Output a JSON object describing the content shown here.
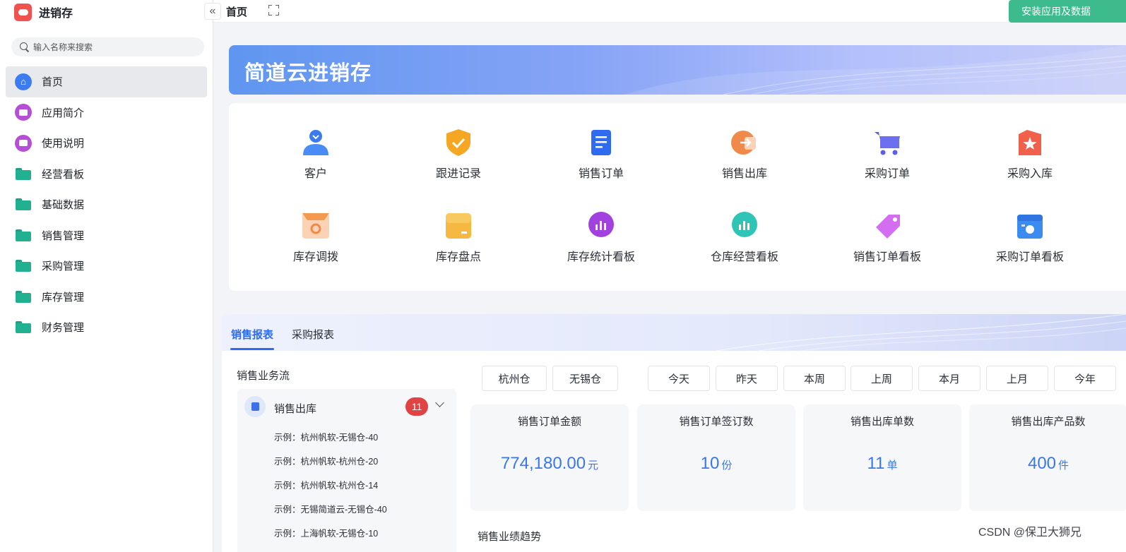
{
  "app": {
    "title": "进销存"
  },
  "sidebar": {
    "search_placeholder": "输入名称来搜索",
    "items": [
      {
        "label": "首页",
        "icon": "home-icon",
        "active": true
      },
      {
        "label": "应用简介",
        "icon": "intro-icon"
      },
      {
        "label": "使用说明",
        "icon": "manual-icon"
      },
      {
        "label": "经营看板",
        "icon": "folder-icon"
      },
      {
        "label": "基础数据",
        "icon": "folder-icon"
      },
      {
        "label": "销售管理",
        "icon": "folder-icon"
      },
      {
        "label": "采购管理",
        "icon": "folder-icon"
      },
      {
        "label": "库存管理",
        "icon": "folder-icon"
      },
      {
        "label": "财务管理",
        "icon": "folder-icon"
      }
    ]
  },
  "topbar": {
    "collapse_glyph": "«",
    "tab": "首页",
    "install_label": "安装应用及数据"
  },
  "banner": {
    "title": "简道云进销存"
  },
  "shortcuts": [
    {
      "label": "客户",
      "icon": "customer-icon"
    },
    {
      "label": "跟进记录",
      "icon": "follow-up-icon"
    },
    {
      "label": "销售订单",
      "icon": "sales-order-icon"
    },
    {
      "label": "销售出库",
      "icon": "sales-outbound-icon"
    },
    {
      "label": "采购订单",
      "icon": "purchase-order-icon"
    },
    {
      "label": "采购入库",
      "icon": "purchase-inbound-icon"
    },
    {
      "label": "库存调拨",
      "icon": "stock-transfer-icon"
    },
    {
      "label": "库存盘点",
      "icon": "stock-count-icon"
    },
    {
      "label": "库存统计看板",
      "icon": "stock-stats-icon"
    },
    {
      "label": "仓库经营看板",
      "icon": "warehouse-dashboard-icon"
    },
    {
      "label": "销售订单看板",
      "icon": "sales-dashboard-icon"
    },
    {
      "label": "采购订单看板",
      "icon": "purchase-dashboard-icon"
    }
  ],
  "report": {
    "tabs": [
      "销售报表",
      "采购报表"
    ],
    "active_tab": "销售报表",
    "flow_title": "销售业务流",
    "flow": {
      "label": "销售出库",
      "badge": "11",
      "rows": [
        "示例：杭州帆软-无锡仓-40",
        "示例：杭州帆软-杭州仓-20",
        "示例：杭州帆软-杭州仓-14",
        "示例：无锡简道云-无锡仓-40",
        "示例：上海帆软-无锡仓-10"
      ]
    },
    "warehouses": [
      "杭州仓",
      "无锡仓"
    ],
    "periods": [
      "今天",
      "昨天",
      "本周",
      "上周",
      "本月",
      "上月",
      "今年"
    ],
    "kpis": [
      {
        "title": "销售订单金额",
        "value": "774,180.00",
        "unit": "元"
      },
      {
        "title": "销售订单签订数",
        "value": "10",
        "unit": "份"
      },
      {
        "title": "销售出库单数",
        "value": "11",
        "unit": "单"
      },
      {
        "title": "销售出库产品数",
        "value": "400",
        "unit": "件"
      }
    ],
    "trend_title": "销售业绩趋势"
  },
  "watermark": "CSDN @保卫大狮兄",
  "colors": {
    "accent": "#2f6bf0",
    "install": "#3dbb8d",
    "badge": "#e04343",
    "kpi_value": "#3b77e8"
  }
}
